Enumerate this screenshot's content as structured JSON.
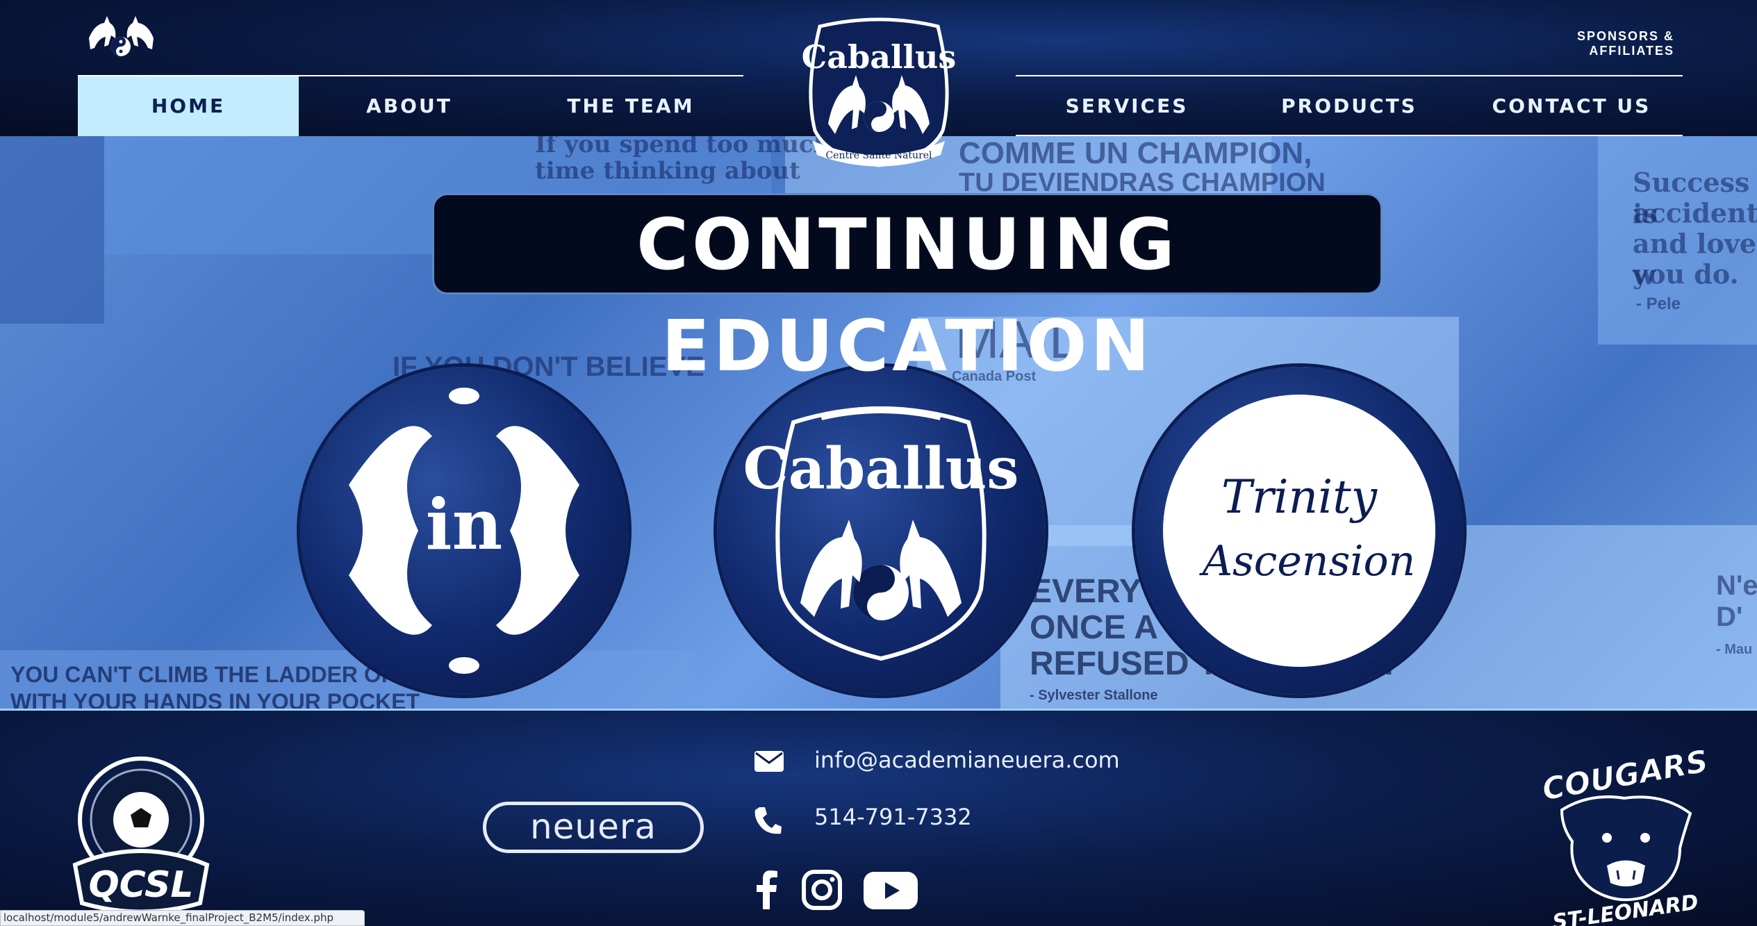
{
  "header": {
    "sponsors_link": "SPONSORS & AFFILIATES",
    "nav_left": [
      "HOME",
      "ABOUT",
      "THE TEAM"
    ],
    "nav_right": [
      "SERVICES",
      "PRODUCTS",
      "CONTACT US"
    ],
    "active_nav": "HOME",
    "crest": {
      "title": "Caballus",
      "ribbon": "Centre Santé Naturel"
    }
  },
  "hero": {
    "title": "CONTINUING EDUCATION",
    "circles": [
      {
        "name": "neuera-in",
        "text": "in"
      },
      {
        "name": "caballus",
        "text": "Caballus"
      },
      {
        "name": "trinity-ascension",
        "line1": "Trinity",
        "line2": "Ascension"
      }
    ],
    "collage_quotes": [
      "If you spend too much",
      "time thinking about",
      "IF YOU DON'T BELIEVE",
      "YOU CAN'T CLIMB THE LADDER OF SUCCESS",
      "WITH YOUR HANDS IN YOUR POCKET",
      "COMME UN CHAMPION,",
      "TU DEVIENDRAS CHAMPION",
      "Success is",
      "accident.",
      "and love w",
      "you do.",
      "- Pele",
      "EVERY CHA",
      "ONCE A CONT",
      "REFUSED TO GIVE UP.",
      "- Sylvester Stallone",
      "MAIL",
      "Canada Post",
      "N'e",
      "D'",
      "- Mau"
    ]
  },
  "footer": {
    "left_logo": "QCSL",
    "center_logo": "neuera",
    "email": "info@academianeuera.com",
    "phone": "514-791-7332",
    "social": [
      "facebook-icon",
      "instagram-icon",
      "youtube-icon"
    ],
    "right_logo": {
      "top": "COUGARS",
      "bottom": "ST-LEONARD"
    }
  },
  "status_bar_url": "localhost/module5/andrewWarnke_finalProject_B2M5/index.php",
  "colors": {
    "accent": "#c3ecff",
    "navy": "#0b1d52",
    "hero_blue": "#5f8fd6"
  }
}
